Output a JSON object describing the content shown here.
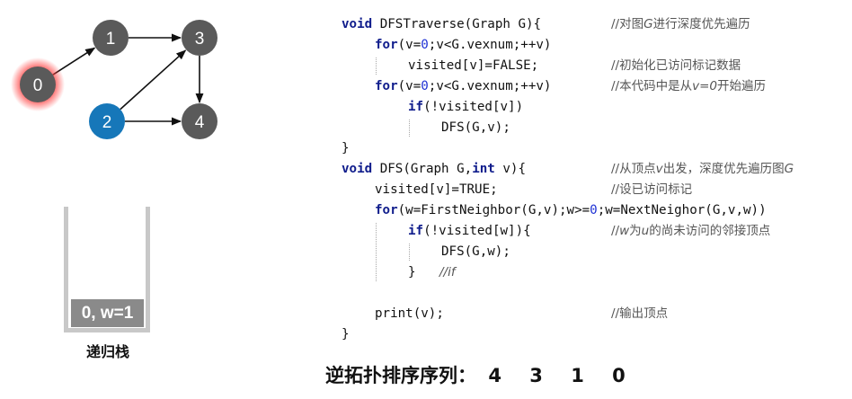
{
  "graph": {
    "nodes": [
      {
        "id": "0",
        "label": "0",
        "color": "#5a5a5a",
        "state": "active"
      },
      {
        "id": "1",
        "label": "1",
        "color": "#5a5a5a"
      },
      {
        "id": "2",
        "label": "2",
        "color": "#1677b9"
      },
      {
        "id": "3",
        "label": "3",
        "color": "#5a5a5a"
      },
      {
        "id": "4",
        "label": "4",
        "color": "#5a5a5a"
      }
    ],
    "edges": [
      [
        "0",
        "1"
      ],
      [
        "1",
        "3"
      ],
      [
        "2",
        "3"
      ],
      [
        "2",
        "4"
      ],
      [
        "3",
        "4"
      ]
    ],
    "highlight_color": "#ff3b3b"
  },
  "stack": {
    "frames": [
      "0, w=1"
    ],
    "caption": "递归栈"
  },
  "code": {
    "lines": [
      {
        "text": "void DFSTraverse(Graph G){",
        "comment": "//对图G进行深度优先遍历"
      },
      {
        "text": "for(v=0;v<G.vexnum;++v)",
        "comment": ""
      },
      {
        "text": "visited[v]=FALSE;",
        "comment": "//初始化已访问标记数据"
      },
      {
        "text": "for(v=0;v<G.vexnum;++v)",
        "comment": "//本代码中是从v=0开始遍历"
      },
      {
        "text": "if(!visited[v])",
        "comment": ""
      },
      {
        "text": "DFS(G,v);",
        "comment": ""
      },
      {
        "text": "}",
        "comment": ""
      },
      {
        "text": "void DFS(Graph G,int v){",
        "comment": "//从顶点v出发，深度优先遍历图G"
      },
      {
        "text": "visited[v]=TRUE;",
        "comment": "//设已访问标记"
      },
      {
        "text": "for(w=FirstNeighbor(G,v);w>=0;w=NextNeighor(G,v,w))",
        "comment": ""
      },
      {
        "text": "if(!visited[w]){",
        "comment": "//w为u的尚未访问的邻接顶点"
      },
      {
        "text": "DFS(G,w);",
        "comment": ""
      },
      {
        "text": "}",
        "comment": "//if"
      },
      {
        "text": "",
        "comment": ""
      },
      {
        "text": "print(v);",
        "comment": "//输出顶点"
      },
      {
        "text": "}",
        "comment": ""
      }
    ]
  },
  "result": {
    "label": "逆拓扑排序序列：",
    "sequence": [
      "4",
      "3",
      "1",
      "0"
    ]
  }
}
